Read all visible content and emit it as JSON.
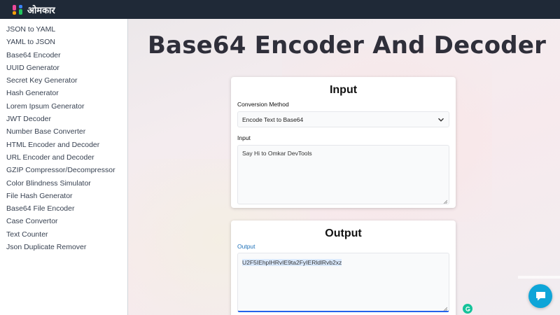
{
  "header": {
    "brand": "ओमकार"
  },
  "sidebar": {
    "items": [
      "JSON to YAML",
      "YAML to JSON",
      "Base64 Encoder",
      "UUID Generator",
      "Secret Key Generator",
      "Hash Generator",
      "Lorem Ipsum Generator",
      "JWT Decoder",
      "Number Base Converter",
      "HTML Encoder and Decoder",
      "URL Encoder and Decoder",
      "GZIP Compressor/Decompressor",
      "Color Blindness Simulator",
      "File Hash Generator",
      "Base64 File Encoder",
      "Case Convertor",
      "Text Counter",
      "Json Duplicate Remover"
    ]
  },
  "main": {
    "title": "Base64 Encoder And Decoder",
    "input_card": {
      "heading": "Input",
      "method_label": "Conversion Method",
      "method_value": "Encode Text to Base64",
      "input_label": "Input",
      "input_value": "Say Hi to Omkar DevTools"
    },
    "output_card": {
      "heading": "Output",
      "output_label": "Output",
      "output_value": "U2F5IEhpIHRvIE9ta2FyIERldlRvb2xz"
    }
  },
  "colors": {
    "topbar": "#1f2937",
    "accent": "#2563eb",
    "chat": "#0ea5d8"
  }
}
